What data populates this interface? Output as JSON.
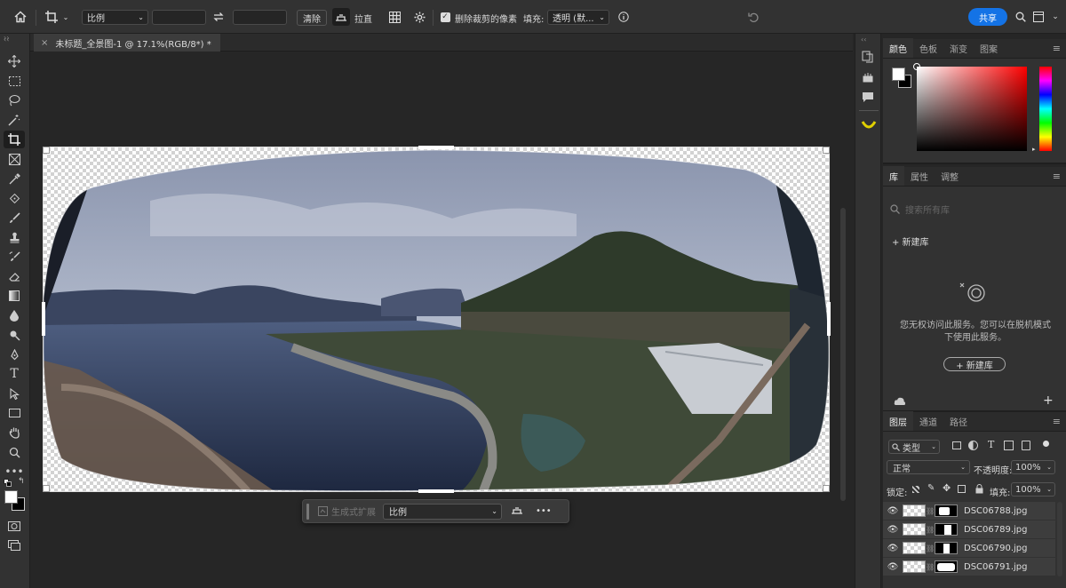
{
  "options_bar": {
    "ratio_select": "比例",
    "clear_label": "清除",
    "straighten_label": "拉直",
    "delete_cropped_label": "删除裁剪的像素",
    "fill_label": "填充:",
    "fill_value": "透明 (默...",
    "share_label": "共享"
  },
  "document_tab": {
    "title": "未标题_全景图-1 @ 17.1%(RGB/8*) *",
    "close": "×"
  },
  "context_bar": {
    "generative_expand": "生成式扩展",
    "ratio_value": "比例",
    "more": "•••"
  },
  "color_panel": {
    "tabs": [
      "颜色",
      "色板",
      "渐变",
      "图案"
    ],
    "foreground": "#ffffff",
    "background": "#000000"
  },
  "library_panel": {
    "tabs": [
      "库",
      "属性",
      "调整"
    ],
    "search_placeholder": "搜索所有库",
    "new_library": "+ 新建库",
    "no_access_message": "您无权访问此服务。您可以在脱机模式下使用此服务。",
    "new_library_button": "+ 新建库"
  },
  "layers_panel": {
    "tabs": [
      "图层",
      "通道",
      "路径"
    ],
    "filter_kind": "类型",
    "blend_mode": "正常",
    "opacity_label": "不透明度:",
    "opacity_value": "100%",
    "lock_label": "锁定:",
    "fill_label": "填充:",
    "fill_value": "100%",
    "layers": [
      {
        "name": "DSC06788.jpg"
      },
      {
        "name": "DSC06789.jpg"
      },
      {
        "name": "DSC06790.jpg"
      },
      {
        "name": "DSC06791.jpg"
      }
    ]
  }
}
